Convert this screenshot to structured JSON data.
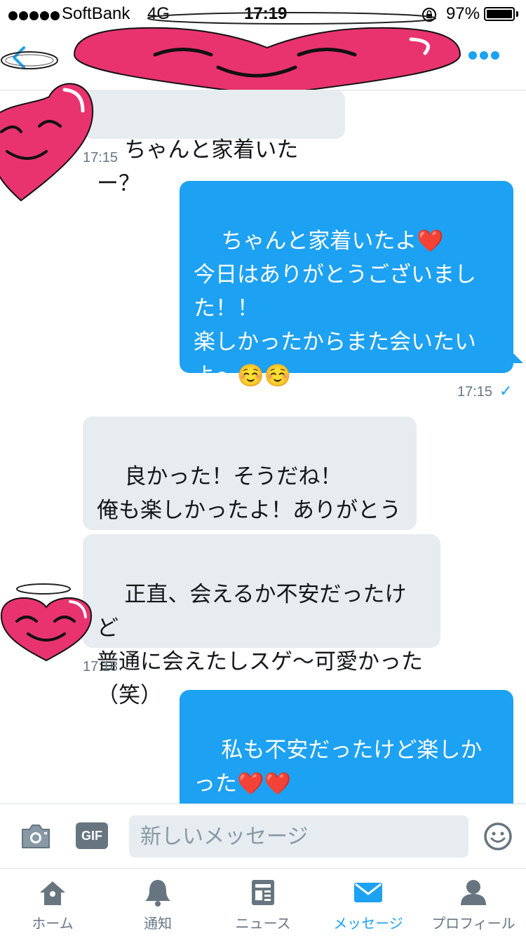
{
  "status_bar": {
    "carrier": "SoftBank",
    "network": "4G",
    "time": "17:19",
    "battery": "97%"
  },
  "nav": {
    "back_icon": "chevron-left-icon",
    "more_icon": "ellipsis-icon"
  },
  "messages": [
    {
      "direction": "in",
      "text": "ちゃんと家着いたー？"
    },
    {
      "direction": "out",
      "text": "ちゃんと家着いたよ❤️\n今日はありがとうございました！！\n楽しかったからまた会いたいよ〜☺️☺️"
    },
    {
      "direction": "in",
      "text": "良かった！そうだね！\n俺も楽しかったよ！ありがとう(^^)"
    },
    {
      "direction": "in",
      "text": "正直、会えるか不安だったけど\n普通に会えたしスゲ〜可愛かった（笑）"
    },
    {
      "direction": "out",
      "text": "私も不安だったけど楽しかった❤️❤️\nありがとう（笑）嬉しい😊"
    }
  ],
  "timestamps": [
    "17:15",
    "17:15",
    "17:18"
  ],
  "composer": {
    "placeholder": "新しいメッセージ",
    "gif_label": "GIF"
  },
  "tabs": [
    {
      "label": "ホーム",
      "icon": "home-icon",
      "active": false
    },
    {
      "label": "通知",
      "icon": "bell-icon",
      "active": false
    },
    {
      "label": "ニュース",
      "icon": "news-icon",
      "active": false
    },
    {
      "label": "メッセージ",
      "icon": "envelope-icon",
      "active": true
    },
    {
      "label": "プロフィール",
      "icon": "person-icon",
      "active": false
    }
  ],
  "colors": {
    "accent": "#1da1f2",
    "incoming_bubble": "#e6ecf0",
    "muted_text": "#657786",
    "sticker_pink": "#e8336f"
  }
}
